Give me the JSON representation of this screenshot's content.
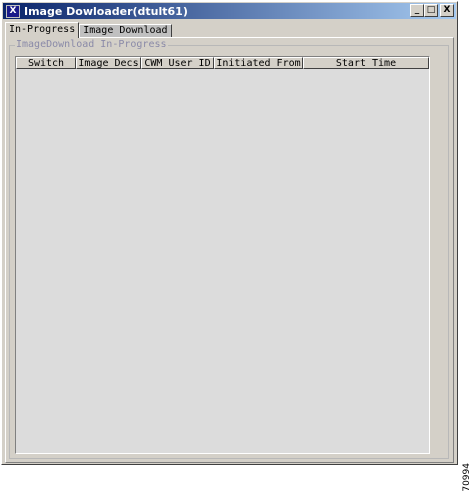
{
  "window": {
    "title": "Image Dowloader(dtult61)",
    "app_icon_letter": "X",
    "controls": {
      "minimize": "_",
      "maximize": "□",
      "close": "X"
    }
  },
  "tabs": [
    {
      "label": "In-Progress",
      "active": true
    },
    {
      "label": "Image Download",
      "active": false
    }
  ],
  "group": {
    "legend": "ImageDownload In-Progress"
  },
  "table": {
    "columns": [
      "Switch",
      "Image Decs",
      "CWM User ID",
      "Initiated From",
      "Start Time"
    ],
    "rows": []
  },
  "figure_code": "70994"
}
